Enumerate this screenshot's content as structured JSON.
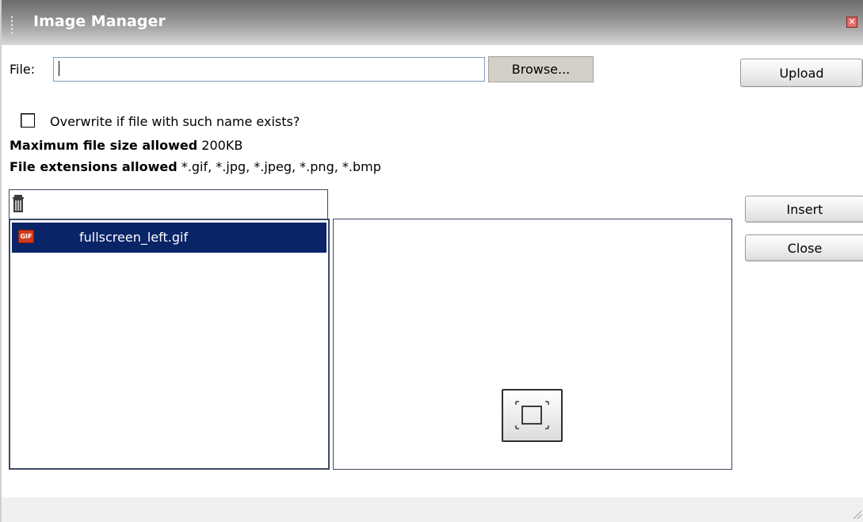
{
  "window": {
    "title": "Image Manager",
    "close_label": "✕"
  },
  "upload_form": {
    "file_label": "File:",
    "file_value": "",
    "browse_label": "Browse...",
    "upload_label": "Upload",
    "overwrite_label": "Overwrite if file with such name exists?",
    "overwrite_checked": false,
    "max_size_heading": "Maximum file size allowed",
    "max_size_value": "200KB",
    "extensions_heading": "File extensions allowed",
    "extensions_value": "*.gif, *.jpg, *.jpeg, *.png, *.bmp"
  },
  "toolbar": {
    "delete_icon": "trash-icon"
  },
  "files": [
    {
      "name": "fullscreen_left.gif",
      "type_badge": "GIF",
      "selected": true
    }
  ],
  "actions": {
    "insert_label": "Insert",
    "close_label": "Close"
  },
  "preview": {
    "icon": "fullscreen-icon"
  },
  "colors": {
    "selection": "#0a2468",
    "border": "#3d4a60",
    "titlebar": "#8a8a8a"
  }
}
